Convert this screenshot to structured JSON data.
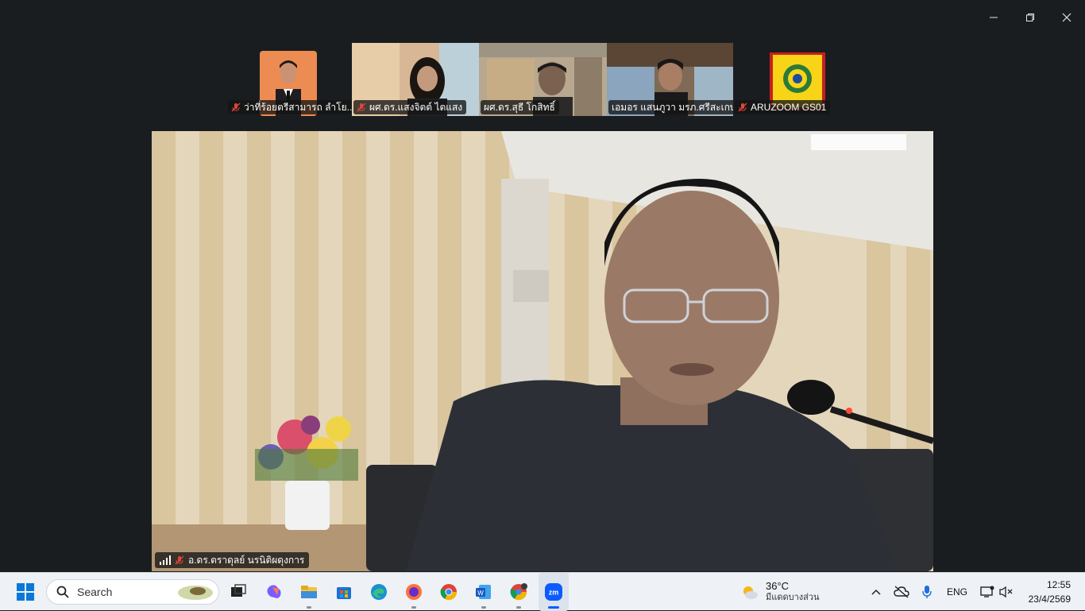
{
  "window": {
    "controls": [
      "minimize-icon",
      "restore-icon",
      "close-icon"
    ]
  },
  "participants": [
    {
      "name": "ว่าที่ร้อยตรีสามารถ ลำโย...",
      "muted": true
    },
    {
      "name": "ผศ.ดร.แสงจิตต์ ไตแสง",
      "muted": true
    },
    {
      "name": "ผศ.ดร.สุธี โกสิทธิ์",
      "muted": false,
      "active": true
    },
    {
      "name": "เอมอร แสนภูวา มรภ.ศรีสะเกษ",
      "muted": false
    },
    {
      "name": "ARUZOOM GS01",
      "muted": true
    }
  ],
  "speaker": {
    "name": "อ.ดร.ตราดุลย์ นรนิติผดุงการ",
    "muted": true
  },
  "taskbar": {
    "search_placeholder": "Search",
    "weather_temp": "36°C",
    "weather_desc": "มีแดดบางส่วน",
    "language": "ENG",
    "time": "12:55",
    "date": "23/4/2569",
    "apps": [
      "task-view",
      "copilot",
      "file-explorer",
      "microsoft-store",
      "edge",
      "firefox",
      "chrome",
      "word",
      "chrome-profile",
      "zoom"
    ]
  },
  "colors": {
    "active_border": "#30c96b",
    "muted_red": "#e0463a",
    "zoom_blue": "#0b5cff"
  }
}
